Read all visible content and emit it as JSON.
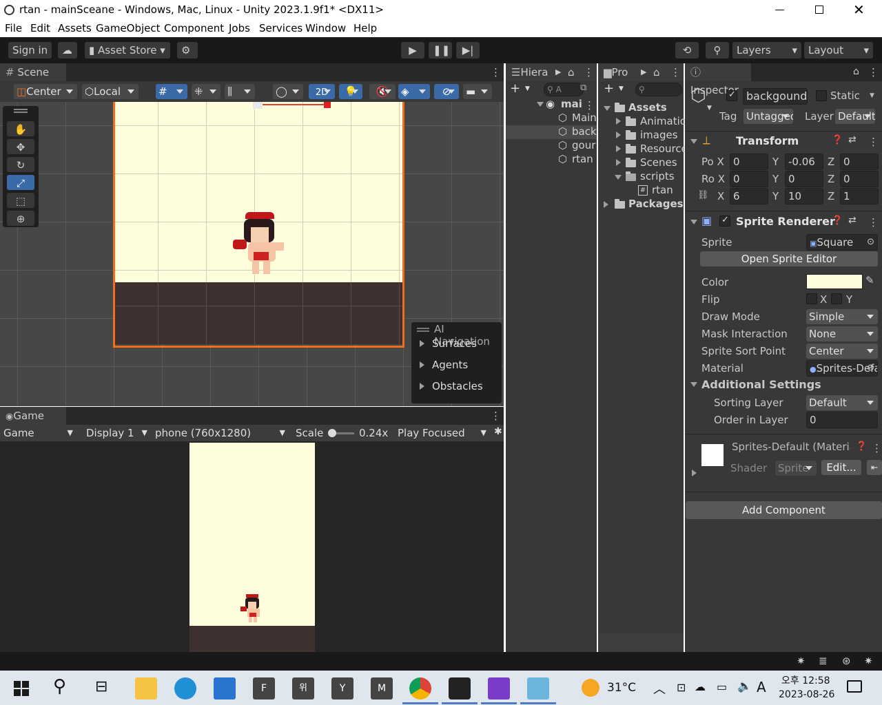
{
  "window": {
    "title": "rtan - mainSceane - Windows, Mac, Linux - Unity 2023.1.9f1* <DX11>"
  },
  "menu": [
    "File",
    "Edit",
    "Assets",
    "GameObject",
    "Component",
    "Jobs",
    "Services",
    "Window",
    "Help"
  ],
  "toolbar": {
    "sign_in": "Sign in",
    "asset_store": "Asset Store",
    "layers": "Layers",
    "layout": "Layout"
  },
  "scene": {
    "tab": "Scene",
    "pivot": "Center",
    "space": "Local",
    "mode_2d": "2D",
    "overlay_title": "AI Navigation",
    "overlay_items": [
      "Surfaces",
      "Agents",
      "Obstacles"
    ],
    "colors": {
      "sky": "#fefedc",
      "ground": "#3f3030",
      "selection": "#f26e1f"
    }
  },
  "game": {
    "tab": "Game",
    "view": "Game",
    "display": "Display 1",
    "resolution": "phone (760x1280)",
    "scale_label": "Scale",
    "scale_value": "0.24x",
    "play_mode": "Play Focused"
  },
  "hierarchy": {
    "tab": "Hiera",
    "search": "A",
    "scene_name": "mai",
    "items": [
      "Main",
      "back",
      "gour",
      "rtan"
    ]
  },
  "project": {
    "tab": "Pro",
    "items": [
      {
        "label": "Assets"
      },
      {
        "label": "Animatio"
      },
      {
        "label": "images"
      },
      {
        "label": "Resource"
      },
      {
        "label": "Scenes"
      },
      {
        "label": "scripts"
      },
      {
        "label": "rtan"
      },
      {
        "label": "Packages"
      }
    ]
  },
  "inspector": {
    "tab": "Inspector",
    "object_name": "backgound",
    "static_label": "Static",
    "tag_label": "Tag",
    "tag_value": "Untagged",
    "layer_label": "Layer",
    "layer_value": "Default",
    "transform": {
      "title": "Transform",
      "position": {
        "label": "Po X",
        "x": "0",
        "y": "-0.06",
        "z": "0"
      },
      "rotation": {
        "label": "Ro X",
        "x": "0",
        "y": "0",
        "z": "0"
      },
      "scale": {
        "label": "X",
        "x": "6",
        "y": "10",
        "z": "1"
      }
    },
    "sprite_renderer": {
      "title": "Sprite Renderer",
      "sprite_label": "Sprite",
      "sprite_value": "Square",
      "open_editor": "Open Sprite Editor",
      "color_label": "Color",
      "color_value": "#fefedc",
      "flip_label": "Flip",
      "flip_x": "X",
      "flip_y": "Y",
      "draw_mode_label": "Draw Mode",
      "draw_mode_value": "Simple",
      "mask_label": "Mask Interaction",
      "mask_value": "None",
      "sort_point_label": "Sprite Sort Point",
      "sort_point_value": "Center",
      "material_label": "Material",
      "material_value": "Sprites-Default",
      "additional": "Additional Settings",
      "sorting_layer_label": "Sorting Layer",
      "sorting_layer_value": "Default",
      "order_label": "Order in Layer",
      "order_value": "0"
    },
    "material": {
      "name": "Sprites-Default (Material)",
      "shader_label": "Shader",
      "shader_value": "Sprite",
      "edit": "Edit..."
    },
    "add_component": "Add Component"
  },
  "taskbar": {
    "temperature": "31°C",
    "time": "오후 12:58",
    "date": "2023-08-26",
    "ime": "A",
    "apps": [
      "F",
      "위",
      "Y",
      "M"
    ]
  }
}
